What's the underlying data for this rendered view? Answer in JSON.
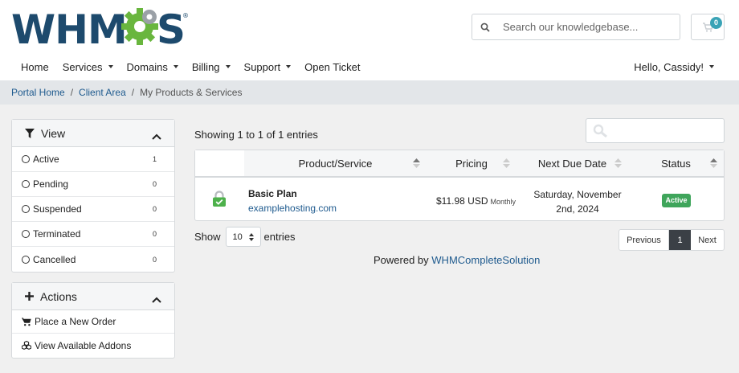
{
  "header": {
    "logo_text": "WHMCS",
    "logo_mark": "®",
    "search_placeholder": "Search our knowledgebase...",
    "cart_count": "0",
    "nav": [
      {
        "label": "Home",
        "dropdown": false
      },
      {
        "label": "Services",
        "dropdown": true
      },
      {
        "label": "Domains",
        "dropdown": true
      },
      {
        "label": "Billing",
        "dropdown": true
      },
      {
        "label": "Support",
        "dropdown": true
      },
      {
        "label": "Open Ticket",
        "dropdown": false
      }
    ],
    "user_greeting": "Hello, Cassidy!"
  },
  "breadcrumb": {
    "items": [
      "Portal Home",
      "Client Area"
    ],
    "separator": "/",
    "current": "My Products & Services"
  },
  "sidebar": {
    "view_panel": {
      "title": "View",
      "filters": [
        {
          "label": "Active",
          "count": "1"
        },
        {
          "label": "Pending",
          "count": "0"
        },
        {
          "label": "Suspended",
          "count": "0"
        },
        {
          "label": "Terminated",
          "count": "0"
        },
        {
          "label": "Cancelled",
          "count": "0"
        }
      ]
    },
    "actions_panel": {
      "title": "Actions",
      "items": [
        {
          "label": "Place a New Order",
          "icon": "cart-icon"
        },
        {
          "label": "View Available Addons",
          "icon": "cubes-icon"
        }
      ]
    }
  },
  "main": {
    "showing_text": "Showing 1 to 1 of 1 entries",
    "table": {
      "columns": [
        "Product/Service",
        "Pricing",
        "Next Due Date",
        "Status"
      ],
      "rows": [
        {
          "product": "Basic Plan",
          "domain": "examplehosting.com",
          "price": "$11.98 USD",
          "cycle": "Monthly",
          "due_line1": "Saturday, November",
          "due_line2": "2nd, 2024",
          "status": "Active"
        }
      ]
    },
    "show_label": "Show",
    "page_size": "10",
    "entries_label": "entries",
    "pager": {
      "prev": "Previous",
      "page": "1",
      "next": "Next"
    },
    "powered_prefix": "Powered by",
    "powered_link": "WHMCompleteSolution"
  },
  "colors": {
    "brand_blue": "#1d4a6d",
    "link_blue": "#1e5a8e",
    "logo_gear_green": "#69b63e",
    "status_active": "#3fa55b",
    "cart_badge": "#3aa3b6",
    "page_bg": "#f0f0f0"
  }
}
